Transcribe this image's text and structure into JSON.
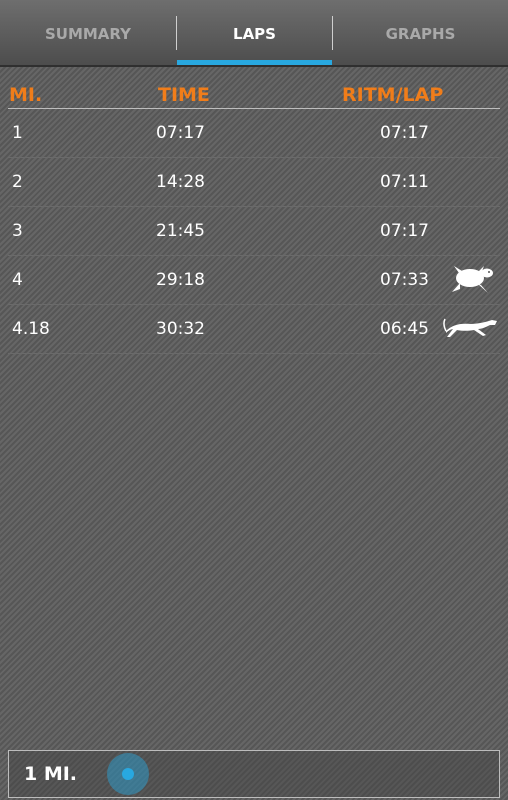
{
  "tabs": [
    {
      "label": "SUMMARY",
      "active": false
    },
    {
      "label": "LAPS",
      "active": true
    },
    {
      "label": "GRAPHS",
      "active": false
    }
  ],
  "laps": {
    "headers": {
      "mi": "MI.",
      "time": "TIME",
      "pace": "RITM/LAP"
    },
    "rows": [
      {
        "mi": "1",
        "time": "07:17",
        "pace": "07:17",
        "icon": ""
      },
      {
        "mi": "2",
        "time": "14:28",
        "pace": "07:11",
        "icon": ""
      },
      {
        "mi": "3",
        "time": "21:45",
        "pace": "07:17",
        "icon": ""
      },
      {
        "mi": "4",
        "time": "29:18",
        "pace": "07:33",
        "icon": "turtle-icon"
      },
      {
        "mi": "4.18",
        "time": "30:32",
        "pace": "06:45",
        "icon": "cheetah-icon"
      }
    ]
  },
  "bottom": {
    "distance_label": "1 MI."
  },
  "colors": {
    "accent": "#28a8e0",
    "header": "#f07d1a"
  }
}
